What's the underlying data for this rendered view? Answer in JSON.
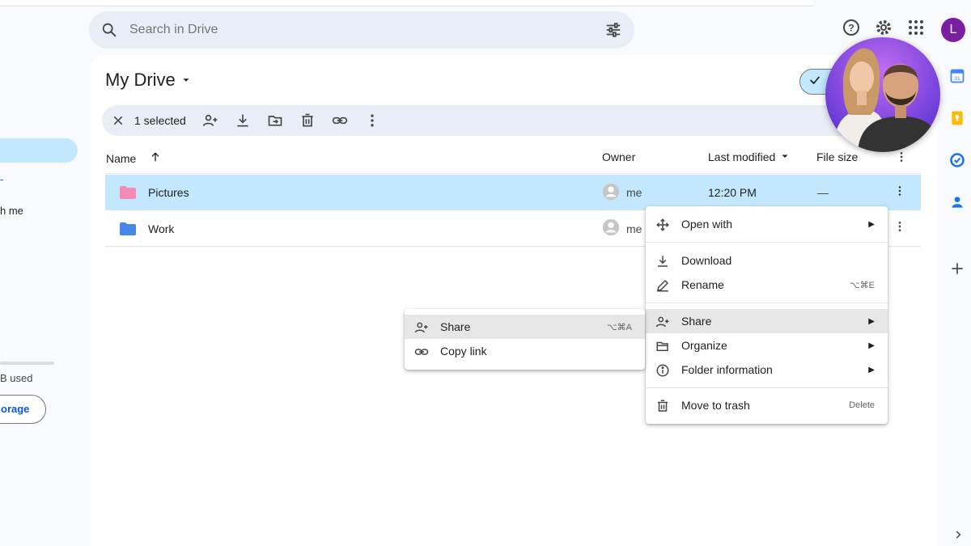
{
  "search": {
    "placeholder": "Search in Drive"
  },
  "header": {
    "avatar_letter": "L"
  },
  "sidebar": {
    "item_fragment": "h me",
    "storage_used": "B used",
    "storage_button": "orage"
  },
  "main": {
    "title": "My Drive"
  },
  "selection": {
    "count_label": "1 selected"
  },
  "columns": {
    "name": "Name",
    "owner": "Owner",
    "last_modified": "Last modified",
    "file_size": "File size"
  },
  "files": [
    {
      "name": "Pictures",
      "owner": "me",
      "modified": "12:20 PM",
      "size": "—",
      "color": "#f28bb5",
      "selected": true
    },
    {
      "name": "Work",
      "owner": "me",
      "modified": "",
      "size": "",
      "color": "#4a86e8",
      "selected": false
    }
  ],
  "context_menu": {
    "open_with": "Open with",
    "download": "Download",
    "rename": "Rename",
    "rename_shortcut": "⌥⌘E",
    "share": "Share",
    "organize": "Organize",
    "folder_information": "Folder information",
    "move_to_trash": "Move to trash",
    "trash_shortcut": "Delete"
  },
  "share_submenu": {
    "share": "Share",
    "share_shortcut": "⌥⌘A",
    "copy_link": "Copy link"
  },
  "colors": {
    "accent": "#0b57d0",
    "selected_row": "#c2e7ff",
    "search_bg": "#e9eef6"
  }
}
